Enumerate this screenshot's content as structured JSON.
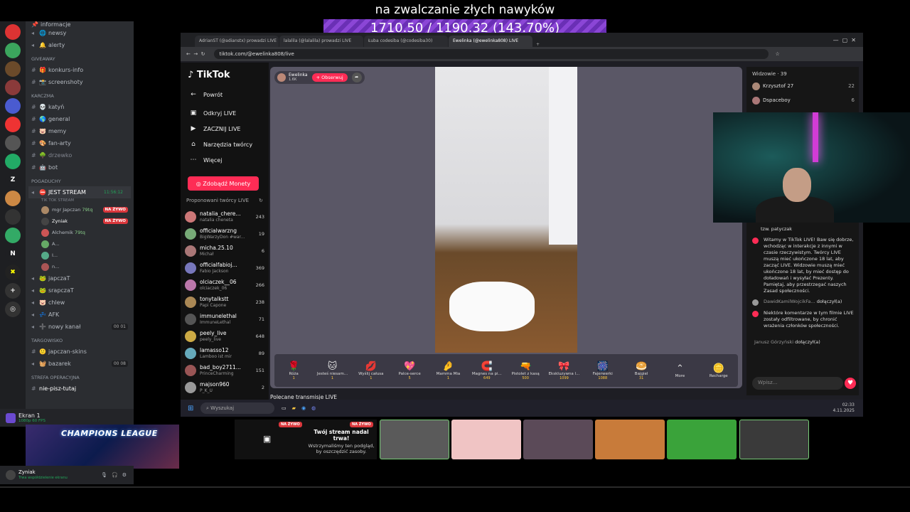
{
  "overlay": {
    "title": "na zwalczanie złych nawyków",
    "progress_text": "1710.50 / 1190.32 (143.70%)",
    "progress_pct": 143.7
  },
  "discord": {
    "server_letters": [
      "Z",
      "N"
    ],
    "categories": {
      "giveaway": "GIVEAWAY",
      "karczma": "KARCZMA",
      "pogaduchy": "POGADUCHY",
      "targowisko": "TARGOWISKO",
      "strefa": "STREFA OPERACYJNA"
    },
    "channels_top": [
      {
        "name": "informacje",
        "emoji": "📌"
      },
      {
        "name": "newsy",
        "emoji": "🌐"
      },
      {
        "name": "alerty",
        "emoji": "🔔"
      }
    ],
    "channels_giveaway": [
      {
        "name": "konkurs-info",
        "emoji": "🎁"
      },
      {
        "name": "screenshoty",
        "emoji": "📸"
      }
    ],
    "channels_karczma": [
      {
        "name": "katyń",
        "emoji": "💀"
      },
      {
        "name": "general",
        "emoji": "🌎"
      },
      {
        "name": "memy",
        "emoji": "🐷"
      },
      {
        "name": "fan-arty",
        "emoji": "🎨"
      },
      {
        "name": "drzewko",
        "emoji": "🌳"
      },
      {
        "name": "bot",
        "emoji": "🤖"
      }
    ],
    "voice_channel": {
      "name": "JEST STREAM",
      "timer": "11:56:12",
      "sub": "TIK TOK STREAM"
    },
    "voice_users": [
      {
        "name": "mgr Japczan",
        "live": true,
        "extra": "79tq"
      },
      {
        "name": "Zyniak",
        "live": true,
        "extra": ""
      },
      {
        "name": "Alchemik",
        "live": false,
        "extra": "79tq"
      },
      {
        "name": "A...",
        "live": false,
        "extra": ""
      },
      {
        "name": "I...",
        "live": false,
        "extra": ""
      },
      {
        "name": "n...",
        "live": false,
        "extra": ""
      }
    ],
    "live_label": "NA ŻYWO",
    "channels_pogaduchy": [
      {
        "name": "japczaT",
        "emoji": "🐸",
        "count": ""
      },
      {
        "name": "srapczaT",
        "emoji": "🐸",
        "count": ""
      },
      {
        "name": "chlew",
        "emoji": "🐷",
        "count": ""
      },
      {
        "name": "AFK",
        "emoji": "💤",
        "count": ""
      },
      {
        "name": "nowy kanał",
        "emoji": "➕",
        "count": "00 01"
      }
    ],
    "channels_targowisko": [
      {
        "name": "japczan-skins",
        "emoji": "🙂",
        "count": ""
      },
      {
        "name": "bazarek",
        "emoji": "🧺",
        "count": "00 08"
      }
    ],
    "channels_strefa": [
      {
        "name": "nie-pisz-tutaj",
        "emoji": "✖"
      }
    ],
    "screen_share": {
      "title": "Ekran 1",
      "sub": "1080p 60 FPS"
    },
    "preview_title": "CHAMPIONS LEAGUE",
    "user": {
      "name": "Zyniak",
      "status": "Trwa współdzielenie ekranu"
    }
  },
  "browser": {
    "tabs": [
      "AdrianST (@adianstx) prowadzi LIVE",
      "lalalila (@lalalila) prowadzi LIVE",
      "Łuba codesiba (@codesiba30)",
      "Ewelinka (@ewelinka808) LIVE"
    ],
    "url": "tiktok.com/@ewelinka808/live"
  },
  "tiktok": {
    "logo": "TikTok",
    "nav": [
      {
        "label": "Powrót",
        "icon": "←"
      },
      {
        "label": "Odkryj LIVE",
        "icon": "▣"
      },
      {
        "label": "ZACZNIJ LIVE",
        "icon": "▶"
      },
      {
        "label": "Narzędzia twórcy",
        "icon": "⌂"
      },
      {
        "label": "Więcej",
        "icon": "⋯"
      }
    ],
    "coins_button": "Zdobądź Monety",
    "suggested_header": "Proponowani twórcy LIVE",
    "creators": [
      {
        "name": "natalia_chere...",
        "sub": "natalia cheneta",
        "viewers": "243",
        "color": "#c77"
      },
      {
        "name": "officialwarzng",
        "sub": "BigWarzyDon #war...",
        "viewers": "19",
        "color": "#7a7"
      },
      {
        "name": "micha.25.10",
        "sub": "Michał",
        "viewers": "6",
        "color": "#a77"
      },
      {
        "name": "officialfabioj...",
        "sub": "Fabio Jackson",
        "viewers": "369",
        "color": "#77b"
      },
      {
        "name": "olciaczek__06",
        "sub": "olciaczek_06",
        "viewers": "266",
        "color": "#b7a"
      },
      {
        "name": "tonytalkstt",
        "sub": "Papi Capone",
        "viewers": "238",
        "color": "#a85"
      },
      {
        "name": "immunelethal",
        "sub": "ImmuneLethal",
        "viewers": "71",
        "color": "#555"
      },
      {
        "name": "peely_live",
        "sub": "peely_live",
        "viewers": "648",
        "color": "#ca4"
      },
      {
        "name": "lamasso12",
        "sub": "Lamboo ist mir",
        "viewers": "89",
        "color": "#6ab"
      },
      {
        "name": "bad_boy2711...",
        "sub": "PrinceCharming",
        "viewers": "151",
        "color": "#955"
      },
      {
        "name": "majson960",
        "sub": "P_K_U",
        "viewers": "2",
        "color": "#999"
      }
    ],
    "streamer": {
      "name": "Ewelinka",
      "likes": "1.6K"
    },
    "follow_label": "+ Obserwuj",
    "gifts": [
      {
        "name": "Róża",
        "icon": "🌹",
        "price": "1"
      },
      {
        "name": "Jesteś niesam...",
        "icon": "🐱",
        "price": "1"
      },
      {
        "name": "Wyślij całusa",
        "icon": "💋",
        "price": "1"
      },
      {
        "name": "Palce-serce",
        "icon": "💖",
        "price": "5"
      },
      {
        "name": "Mamma Mia",
        "icon": "🤌",
        "price": "1"
      },
      {
        "name": "Magnes na pi...",
        "icon": "🧲",
        "price": "649"
      },
      {
        "name": "Pistolet z kasą",
        "icon": "🔫",
        "price": "500"
      },
      {
        "name": "Ekskluzywna l...",
        "icon": "🎀",
        "price": "1099"
      },
      {
        "name": "Fajerwerki",
        "icon": "🎆",
        "price": "1088"
      },
      {
        "name": "Bajgiel",
        "icon": "🥯",
        "price": "31"
      },
      {
        "name": "More",
        "icon": "⌃",
        "price": ""
      },
      {
        "name": "Recharge",
        "icon": "🪙",
        "price": ""
      }
    ],
    "recommended_label": "Polecane transmisje LIVE",
    "viewers_header": "Widzowie · 39",
    "viewers": [
      {
        "name": "Krzysztof 27",
        "count": "22",
        "color": "#a87"
      },
      {
        "name": "Dspaceboy",
        "count": "6",
        "color": "#a77"
      }
    ],
    "chat": [
      {
        "user": "",
        "text": "tzw. patyczak"
      },
      {
        "user": "",
        "text": "Witamy w TikTok LIVE! Baw się dobrze, wchodząc w interakcje z innymi w czasie rzeczywistym. Twórcy LIVE muszą mieć ukończone 18 lat, aby zacząć LIVE. Widzowie muszą mieć ukończone 18 lat, by mieć dostęp do doładowań i wysyłać Prezenty. Pamiętaj, aby przestrzegać naszych Zasad społeczności."
      },
      {
        "user": "DawidKamilWojcikFa...",
        "text": "dołączył(a)"
      },
      {
        "user": "",
        "text": "Niektóre komentarze w tym filmie LIVE zostały odfiltrowane, by chronić wrażenia członków społeczności."
      },
      {
        "user": "Janusz Górzyński",
        "text": "dołączył(a)"
      }
    ],
    "chat_placeholder": "Wpisz..."
  },
  "taskbar": {
    "search": "Wyszukaj",
    "time": "02:33",
    "date": "4.11.2025"
  },
  "stream_strip": {
    "ended_title": "Twój stream nadal trwa!",
    "ended_text": "Wstrzymaliśmy ten podgląd, by oszczędzić zasoby.",
    "live_label": "NA ŻYWO",
    "tiles": [
      "#5a5a5a",
      "#f0c4c4",
      "#5b4a58",
      "#c87b3a",
      "#3aa33a",
      "#3a3a3a"
    ]
  }
}
